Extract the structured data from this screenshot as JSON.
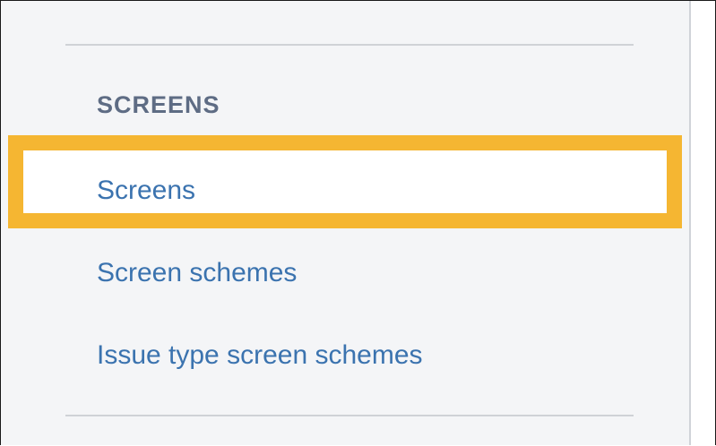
{
  "sidebar": {
    "section_heading": "SCREENS",
    "items": [
      {
        "label": "Screens",
        "selected": true
      },
      {
        "label": "Screen schemes",
        "selected": false
      },
      {
        "label": "Issue type screen schemes",
        "selected": false
      }
    ]
  },
  "colors": {
    "highlight": "#f5b632",
    "link": "#3b73af",
    "heading": "#5e6c84",
    "sidebar_background": "#f4f5f7"
  }
}
